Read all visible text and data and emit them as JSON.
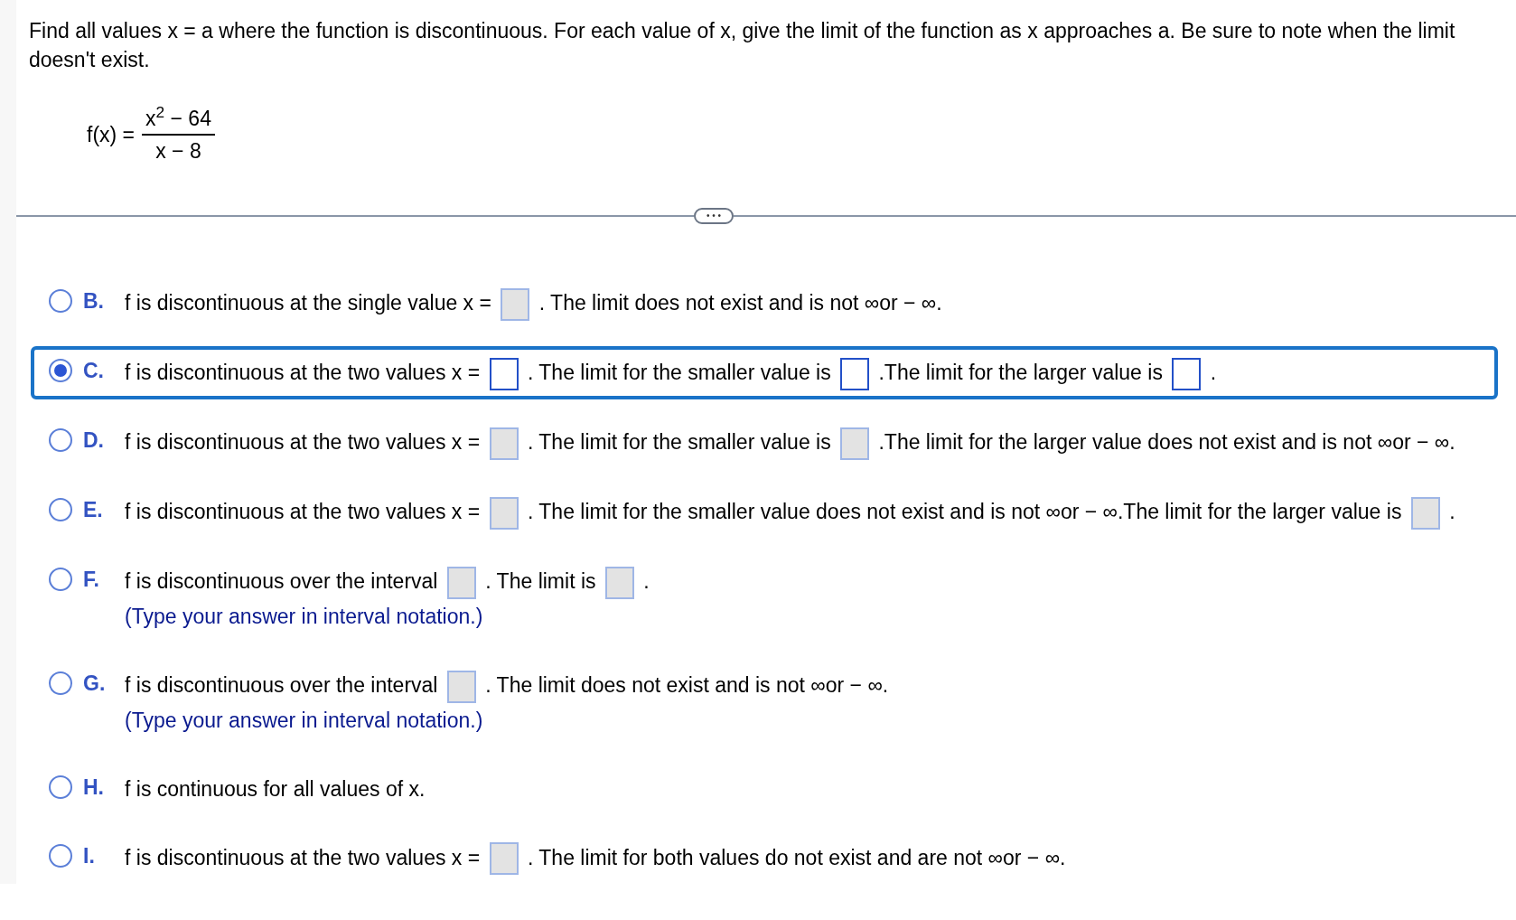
{
  "question": "Find all values x = a where the function is discontinuous. For each value of x, give the limit of the function as x approaches a. Be sure to note when the limit doesn't exist.",
  "function": {
    "name": "f(x) =",
    "numerator": "x$^{2}$ − 64",
    "denominator": "x − 8"
  },
  "divider": {
    "label": "• • •"
  },
  "options": [
    {
      "letter": "B.",
      "selected": false,
      "parts": [
        {
          "kind": "text",
          "text": "f is discontinuous at the single value x ="
        },
        {
          "kind": "box"
        },
        {
          "kind": "text",
          "text": ". The limit does not exist and is not ∞or − ∞."
        }
      ]
    },
    {
      "letter": "C.",
      "selected": true,
      "parts": [
        {
          "kind": "text",
          "text": "f is discontinuous at the two values x ="
        },
        {
          "kind": "box"
        },
        {
          "kind": "text",
          "text": ". The limit for the smaller value is"
        },
        {
          "kind": "box"
        },
        {
          "kind": "text",
          "text": ".The limit for the larger value is"
        },
        {
          "kind": "box"
        },
        {
          "kind": "text",
          "text": "."
        }
      ]
    },
    {
      "letter": "D.",
      "selected": false,
      "parts": [
        {
          "kind": "text",
          "text": "f is discontinuous at the two values x ="
        },
        {
          "kind": "box"
        },
        {
          "kind": "text",
          "text": ". The limit for the smaller value is"
        },
        {
          "kind": "box"
        },
        {
          "kind": "text",
          "text": ".The limit for the larger value does not exist and is not ∞or − ∞."
        }
      ]
    },
    {
      "letter": "E.",
      "selected": false,
      "parts": [
        {
          "kind": "text",
          "text": "f is discontinuous at the two values x ="
        },
        {
          "kind": "box"
        },
        {
          "kind": "text",
          "text": ". The limit for the smaller value does not exist and is not ∞or − ∞.The limit for the larger value is"
        },
        {
          "kind": "box"
        },
        {
          "kind": "text",
          "text": "."
        }
      ]
    },
    {
      "letter": "F.",
      "selected": false,
      "parts": [
        {
          "kind": "text",
          "text": "f is discontinuous over the interval"
        },
        {
          "kind": "box"
        },
        {
          "kind": "text",
          "text": ". The limit is"
        },
        {
          "kind": "box"
        },
        {
          "kind": "text",
          "text": "."
        }
      ],
      "note": "(Type your answer in interval notation.)"
    },
    {
      "letter": "G.",
      "selected": false,
      "parts": [
        {
          "kind": "text",
          "text": "f is discontinuous over the interval"
        },
        {
          "kind": "box"
        },
        {
          "kind": "text",
          "text": ". The limit does not exist and is not ∞or − ∞."
        }
      ],
      "note": "(Type your answer in interval notation.)"
    },
    {
      "letter": "H.",
      "selected": false,
      "parts": [
        {
          "kind": "text",
          "text": "f is continuous for all values of x."
        }
      ]
    },
    {
      "letter": "I.",
      "selected": false,
      "parts": [
        {
          "kind": "text",
          "text": "f is discontinuous at the two values x ="
        },
        {
          "kind": "box"
        },
        {
          "kind": "text",
          "text": ". The limit for both values do not exist and are not ∞or − ∞."
        }
      ]
    }
  ]
}
